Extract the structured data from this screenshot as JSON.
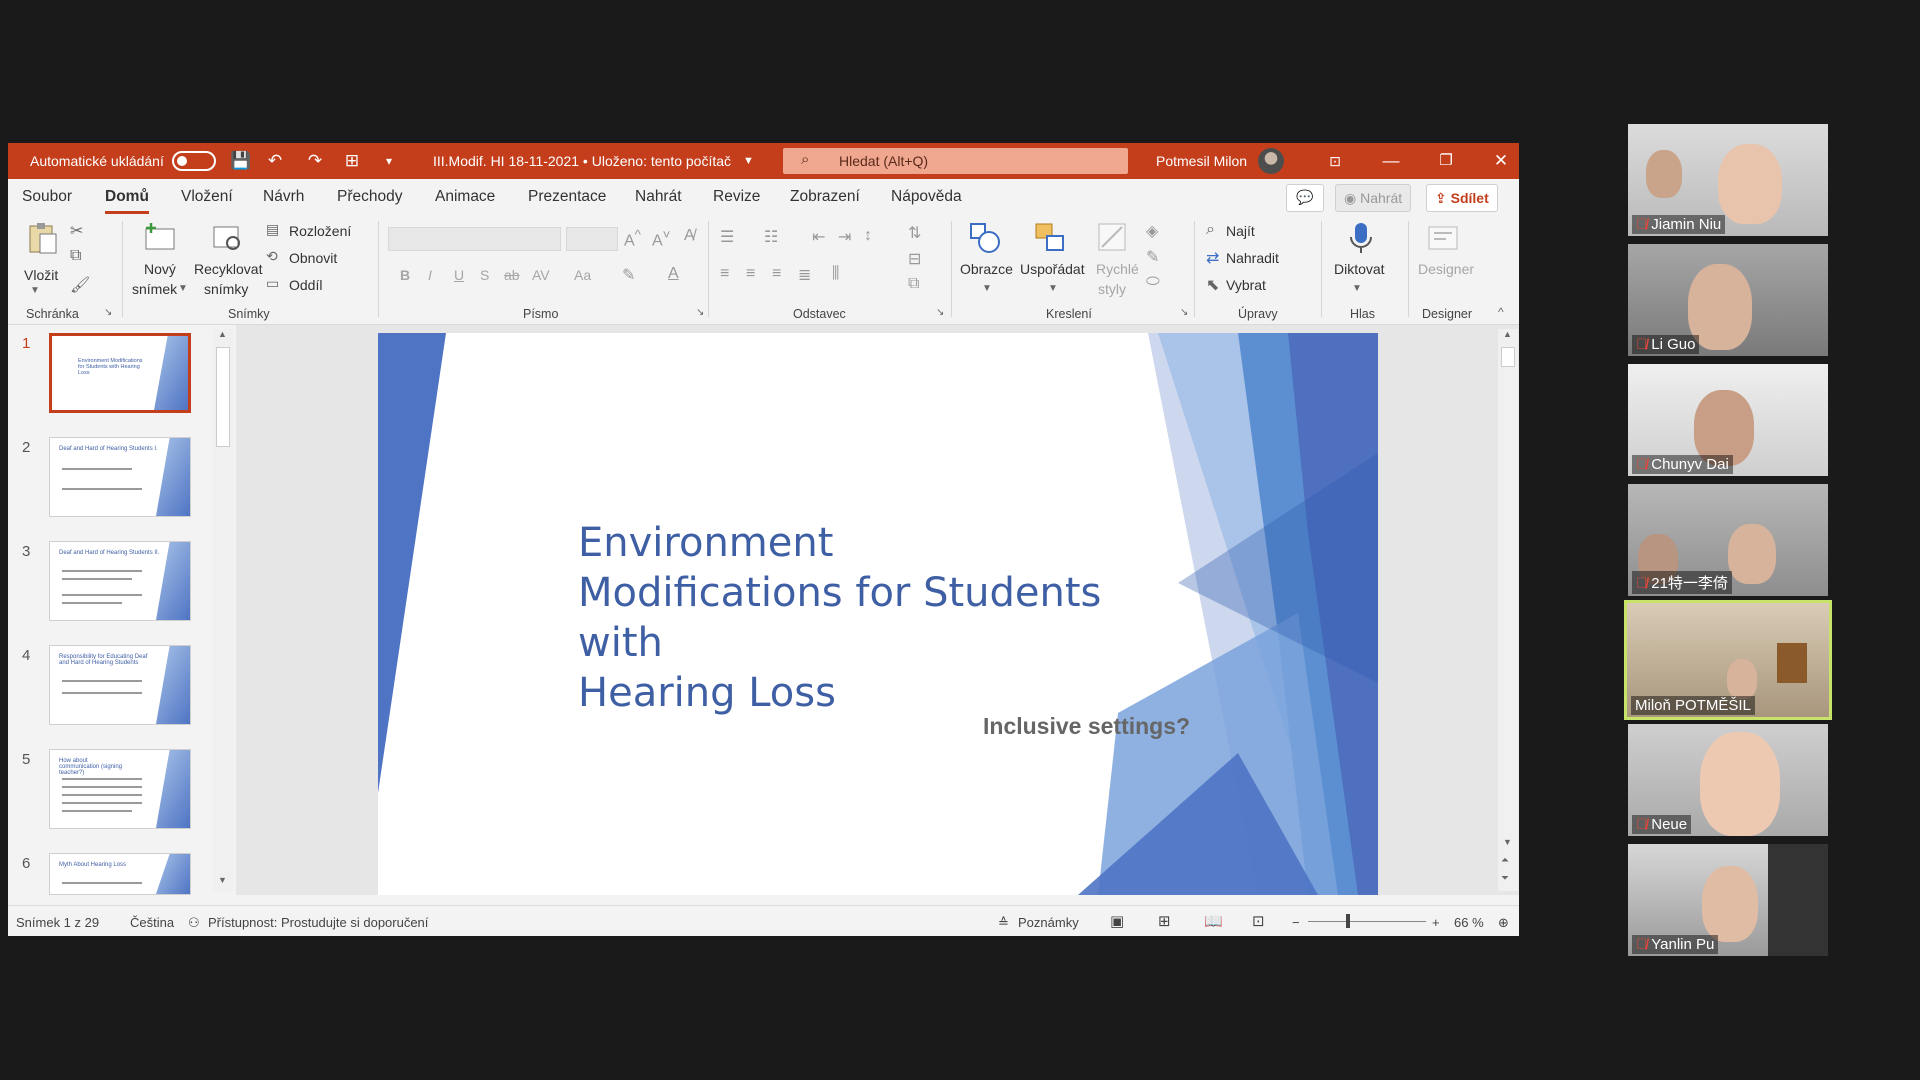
{
  "titlebar": {
    "autosave_label": "Automatické ukládání",
    "doc_title": "III.Modif. HI 18-11-2021 • Uloženo: tento počítač",
    "search_placeholder": "Hledat (Alt+Q)",
    "user_name": "Potmesil Milon"
  },
  "menu": {
    "tabs": [
      "Soubor",
      "Domů",
      "Vložení",
      "Návrh",
      "Přechody",
      "Animace",
      "Prezentace",
      "Nahrát",
      "Revize",
      "Zobrazení",
      "Nápověda"
    ],
    "active": "Domů",
    "record_label": "Nahrát",
    "share_label": "Sdílet"
  },
  "ribbon": {
    "clipboard": {
      "paste": "Vložit",
      "group": "Schránka"
    },
    "slides": {
      "new_line1": "Nový",
      "new_line2": "snímek",
      "recycle_line1": "Recyklovat",
      "recycle_line2": "snímky",
      "layout": "Rozložení",
      "reset": "Obnovit",
      "section": "Oddíl",
      "group": "Snímky"
    },
    "font": {
      "group": "Písmo",
      "bold": "B",
      "italic": "I",
      "underline": "U",
      "shadow": "S",
      "strike": "ab",
      "spacing": "AV",
      "case": "Aa"
    },
    "paragraph": {
      "group": "Odstavec"
    },
    "drawing": {
      "shapes": "Obrazce",
      "arrange": "Uspořádat",
      "quick_line1": "Rychlé",
      "quick_line2": "styly",
      "group": "Kreslení"
    },
    "editing": {
      "find": "Najít",
      "replace": "Nahradit",
      "select": "Vybrat",
      "group": "Úpravy"
    },
    "voice": {
      "dictate": "Diktovat",
      "group": "Hlas"
    },
    "designer": {
      "label": "Designer",
      "group": "Designer"
    }
  },
  "thumbnails": [
    {
      "num": "1",
      "title": "Environment Modifications for Students with Hearing Loss"
    },
    {
      "num": "2",
      "title": "Deaf and Hard of Hearing Students I."
    },
    {
      "num": "3",
      "title": "Deaf and Hard of Hearing Students II."
    },
    {
      "num": "4",
      "title": "Responsibility for Educating Deaf and Hard of Hearing Students"
    },
    {
      "num": "5",
      "title": "How about communication (signing teacher?)"
    },
    {
      "num": "6",
      "title": "Myth About Hearing Loss"
    }
  ],
  "slide": {
    "title_lines": [
      "Environment",
      "Modifications for Students with",
      "Hearing Loss"
    ],
    "subtitle": "Inclusive settings?"
  },
  "status": {
    "slide_counter": "Snímek 1 z 29",
    "language": "Čeština",
    "accessibility": "Přístupnost: Prostudujte si doporučení",
    "notes": "Poznámky",
    "zoom": "66 %"
  },
  "participants": [
    {
      "name": "Jiamin Niu"
    },
    {
      "name": "Li Guo"
    },
    {
      "name": "Chunyv Dai"
    },
    {
      "name": "21特一李倚"
    },
    {
      "name": "Miloň POTMĚŠIL"
    },
    {
      "name": "Neue"
    },
    {
      "name": "Yanlin Pu"
    }
  ],
  "colors": {
    "ppt_accent": "#c43e1c",
    "slide_title": "#3f5fa5",
    "active_speaker": "#c8e36a"
  }
}
